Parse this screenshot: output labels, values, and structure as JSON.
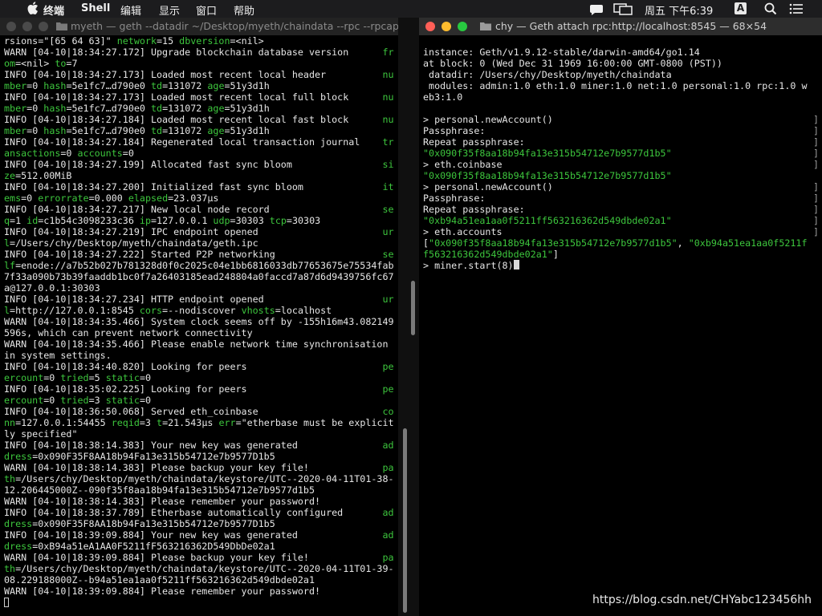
{
  "menubar": {
    "app_name": "终端",
    "menus": [
      "Shell",
      "编辑",
      "显示",
      "窗口",
      "帮助"
    ],
    "clock": "周五 下午6:39",
    "input_method": "A"
  },
  "left_window": {
    "title": "myeth — geth --datadir ~/Desktop/myeth/chaindata --rpc --rpcapi e..."
  },
  "right_window": {
    "title": "chy — Geth attach rpc:http://localhost:8545 — 68×54"
  },
  "left_lines": [
    [
      [
        "rsions=\"[65 64 63]\" ",
        ""
      ],
      [
        "network",
        "g"
      ],
      [
        "=15 ",
        ""
      ],
      [
        "dbversion",
        "g"
      ],
      [
        "=<nil>",
        ""
      ]
    ],
    [
      [
        "WARN [04-10|18:34:27.172] Upgrade blockchain database version      ",
        ""
      ],
      [
        "fr",
        "g"
      ]
    ],
    [
      [
        "om",
        "g"
      ],
      [
        "=<nil> ",
        ""
      ],
      [
        "to",
        "g"
      ],
      [
        "=7",
        ""
      ]
    ],
    [
      [
        "INFO [04-10|18:34:27.173] Loaded most recent local header          ",
        ""
      ],
      [
        "nu",
        "g"
      ]
    ],
    [
      [
        "mber",
        "g"
      ],
      [
        "=0 ",
        ""
      ],
      [
        "hash",
        "g"
      ],
      [
        "=5e1fc7…d790e0 ",
        ""
      ],
      [
        "td",
        "g"
      ],
      [
        "=131072 ",
        ""
      ],
      [
        "age",
        "g"
      ],
      [
        "=51y3d1h",
        ""
      ]
    ],
    [
      [
        "INFO [04-10|18:34:27.173] Loaded most recent local full block      ",
        ""
      ],
      [
        "nu",
        "g"
      ]
    ],
    [
      [
        "mber",
        "g"
      ],
      [
        "=0 ",
        ""
      ],
      [
        "hash",
        "g"
      ],
      [
        "=5e1fc7…d790e0 ",
        ""
      ],
      [
        "td",
        "g"
      ],
      [
        "=131072 ",
        ""
      ],
      [
        "age",
        "g"
      ],
      [
        "=51y3d1h",
        ""
      ]
    ],
    [
      [
        "INFO [04-10|18:34:27.184] Loaded most recent local fast block      ",
        ""
      ],
      [
        "nu",
        "g"
      ]
    ],
    [
      [
        "mber",
        "g"
      ],
      [
        "=0 ",
        ""
      ],
      [
        "hash",
        "g"
      ],
      [
        "=5e1fc7…d790e0 ",
        ""
      ],
      [
        "td",
        "g"
      ],
      [
        "=131072 ",
        ""
      ],
      [
        "age",
        "g"
      ],
      [
        "=51y3d1h",
        ""
      ]
    ],
    [
      [
        "INFO [04-10|18:34:27.184] Regenerated local transaction journal    ",
        ""
      ],
      [
        "tr",
        "g"
      ]
    ],
    [
      [
        "ansactions",
        "g"
      ],
      [
        "=0 ",
        ""
      ],
      [
        "accounts",
        "g"
      ],
      [
        "=0",
        ""
      ]
    ],
    [
      [
        "INFO [04-10|18:34:27.199] Allocated fast sync bloom                ",
        ""
      ],
      [
        "si",
        "g"
      ]
    ],
    [
      [
        "ze",
        "g"
      ],
      [
        "=512.00MiB",
        ""
      ]
    ],
    [
      [
        "INFO [04-10|18:34:27.200] Initialized fast sync bloom              ",
        ""
      ],
      [
        "it",
        "g"
      ]
    ],
    [
      [
        "ems",
        "g"
      ],
      [
        "=0 ",
        ""
      ],
      [
        "errorrate",
        "g"
      ],
      [
        "=0.000 ",
        ""
      ],
      [
        "elapsed",
        "g"
      ],
      [
        "=23.037µs",
        ""
      ]
    ],
    [
      [
        "INFO [04-10|18:34:27.217] New local node record                    ",
        ""
      ],
      [
        "se",
        "g"
      ]
    ],
    [
      [
        "q",
        "g"
      ],
      [
        "=1 ",
        ""
      ],
      [
        "id",
        "g"
      ],
      [
        "=c1b54c3098233c36 ",
        ""
      ],
      [
        "ip",
        "g"
      ],
      [
        "=127.0.0.1 ",
        ""
      ],
      [
        "udp",
        "g"
      ],
      [
        "=30303 ",
        ""
      ],
      [
        "tcp",
        "g"
      ],
      [
        "=30303",
        ""
      ]
    ],
    [
      [
        "INFO [04-10|18:34:27.219] IPC endpoint opened                      ",
        ""
      ],
      [
        "ur",
        "g"
      ]
    ],
    [
      [
        "l",
        "g"
      ],
      [
        "=/Users/chy/Desktop/myeth/chaindata/geth.ipc",
        ""
      ]
    ],
    [
      [
        "INFO [04-10|18:34:27.222] Started P2P networking                   ",
        ""
      ],
      [
        "se",
        "g"
      ]
    ],
    [
      [
        "lf",
        "g"
      ],
      [
        "=enode://a7b52b027b781328d0f0c2025c04e1bb6816033db77653675e75534fab",
        ""
      ]
    ],
    [
      [
        "7f33a090b73b39faaddb1bc0f7a26403185ead248804a0faccd7a87d6d9439756fc67",
        ""
      ]
    ],
    [
      [
        "a@127.0.0.1:30303",
        ""
      ]
    ],
    [
      [
        "INFO [04-10|18:34:27.234] HTTP endpoint opened                     ",
        ""
      ],
      [
        "ur",
        "g"
      ]
    ],
    [
      [
        "l",
        "g"
      ],
      [
        "=http://127.0.0.1:8545 ",
        ""
      ],
      [
        "cors",
        "g"
      ],
      [
        "=--nodiscover ",
        ""
      ],
      [
        "vhosts",
        "g"
      ],
      [
        "=localhost",
        ""
      ]
    ],
    [
      [
        "WARN [04-10|18:34:35.466] System clock seems off by -155h16m43.082149",
        ""
      ]
    ],
    [
      [
        "596s, which can prevent network connectivity",
        ""
      ]
    ],
    [
      [
        "WARN [04-10|18:34:35.466] Please enable network time synchronisation",
        ""
      ]
    ],
    [
      [
        "in system settings.",
        ""
      ]
    ],
    [
      [
        "INFO [04-10|18:34:40.820] Looking for peers                        ",
        ""
      ],
      [
        "pe",
        "g"
      ]
    ],
    [
      [
        "ercount",
        "g"
      ],
      [
        "=0 ",
        ""
      ],
      [
        "tried",
        "g"
      ],
      [
        "=5 ",
        ""
      ],
      [
        "static",
        "g"
      ],
      [
        "=0",
        ""
      ]
    ],
    [
      [
        "INFO [04-10|18:35:02.225] Looking for peers                        ",
        ""
      ],
      [
        "pe",
        "g"
      ]
    ],
    [
      [
        "ercount",
        "g"
      ],
      [
        "=0 ",
        ""
      ],
      [
        "tried",
        "g"
      ],
      [
        "=3 ",
        ""
      ],
      [
        "static",
        "g"
      ],
      [
        "=0",
        ""
      ]
    ],
    [
      [
        "INFO [04-10|18:36:50.068] Served eth_coinbase                      ",
        ""
      ],
      [
        "co",
        "g"
      ]
    ],
    [
      [
        "nn",
        "g"
      ],
      [
        "=127.0.0.1:54455 ",
        ""
      ],
      [
        "reqid",
        "g"
      ],
      [
        "=3 ",
        ""
      ],
      [
        "t",
        "g"
      ],
      [
        "=21.543µs ",
        ""
      ],
      [
        "err",
        "g"
      ],
      [
        "=\"etherbase must be explicit",
        ""
      ]
    ],
    [
      [
        "ly specified\"",
        ""
      ]
    ],
    [
      [
        "INFO [04-10|18:38:14.383] Your new key was generated               ",
        ""
      ],
      [
        "ad",
        "g"
      ]
    ],
    [
      [
        "dress",
        "g"
      ],
      [
        "=0x090F35F8AA18b94Fa13e315b54712e7b9577D1b5",
        ""
      ]
    ],
    [
      [
        "WARN [04-10|18:38:14.383] Please backup your key file!             ",
        ""
      ],
      [
        "pa",
        "g"
      ]
    ],
    [
      [
        "th",
        "g"
      ],
      [
        "=/Users/chy/Desktop/myeth/chaindata/keystore/UTC--2020-04-11T01-38-",
        ""
      ]
    ],
    [
      [
        "12.206445000Z--090f35f8aa18b94fa13e315b54712e7b9577d1b5",
        ""
      ]
    ],
    [
      [
        "WARN [04-10|18:38:14.383] Please remember your password!",
        ""
      ]
    ],
    [
      [
        "INFO [04-10|18:38:37.789] Etherbase automatically configured       ",
        ""
      ],
      [
        "ad",
        "g"
      ]
    ],
    [
      [
        "dress",
        "g"
      ],
      [
        "=0x090F35F8AA18b94Fa13e315b54712e7b9577D1b5",
        ""
      ]
    ],
    [
      [
        "INFO [04-10|18:39:09.884] Your new key was generated               ",
        ""
      ],
      [
        "ad",
        "g"
      ]
    ],
    [
      [
        "dress",
        "g"
      ],
      [
        "=0xB94a51eA1AA0F5211fF563216362D549DbDe02a1",
        ""
      ]
    ],
    [
      [
        "WARN [04-10|18:39:09.884] Please backup your key file!             ",
        ""
      ],
      [
        "pa",
        "g"
      ]
    ],
    [
      [
        "th",
        "g"
      ],
      [
        "=/Users/chy/Desktop/myeth/chaindata/keystore/UTC--2020-04-11T01-39-",
        ""
      ]
    ],
    [
      [
        "08.229188000Z--b94a51ea1aa0f5211ff563216362d549dbde02a1",
        ""
      ]
    ],
    [
      [
        "WARN [04-10|18:39:09.884] Please remember your password!",
        ""
      ]
    ]
  ],
  "right_lines": [
    [
      [
        "",
        ""
      ]
    ],
    [
      [
        "instance: Geth/v1.9.12-stable/darwin-amd64/go1.14",
        ""
      ]
    ],
    [
      [
        "at block: 0 (Wed Dec 31 1969 16:00:00 GMT-0800 (PST))",
        ""
      ]
    ],
    [
      [
        " datadir: /Users/chy/Desktop/myeth/chaindata",
        ""
      ]
    ],
    [
      [
        " modules: admin:1.0 eth:1.0 miner:1.0 net:1.0 personal:1.0 rpc:1.0 w",
        ""
      ]
    ],
    [
      [
        "eb3:1.0",
        ""
      ]
    ],
    [
      [
        "",
        ""
      ]
    ],
    [
      [
        "> personal.newAccount()",
        ""
      ]
    ],
    [
      [
        "Passphrase:",
        ""
      ]
    ],
    [
      [
        "Repeat passphrase:",
        ""
      ]
    ],
    [
      [
        "\"0x090f35f8aa18b94fa13e315b54712e7b9577d1b5\"",
        "g"
      ]
    ],
    [
      [
        "> eth.coinbase",
        ""
      ]
    ],
    [
      [
        "\"0x090f35f8aa18b94fa13e315b54712e7b9577d1b5\"",
        "g"
      ]
    ],
    [
      [
        "> personal.newAccount()",
        ""
      ]
    ],
    [
      [
        "Passphrase:",
        ""
      ]
    ],
    [
      [
        "Repeat passphrase:",
        ""
      ]
    ],
    [
      [
        "\"0xb94a51ea1aa0f5211ff563216362d549dbde02a1\"",
        "g"
      ]
    ],
    [
      [
        "> eth.accounts",
        ""
      ]
    ],
    [
      [
        "[",
        ""
      ],
      [
        "\"0x090f35f8aa18b94fa13e315b54712e7b9577d1b5\"",
        "g"
      ],
      [
        ", ",
        ""
      ],
      [
        "\"0xb94a51ea1aa0f5211f",
        "g"
      ]
    ],
    [
      [
        "f563216362d549dbde02a1\"",
        "g"
      ],
      [
        "]",
        ""
      ]
    ],
    [
      [
        "> miner.start(8)",
        ""
      ]
    ]
  ],
  "watermark": "https://blog.csdn.net/CHYabc123456hh",
  "colors": {
    "green": "#3dc63d",
    "text": "#e6e6e6",
    "red": "#ff5f57",
    "yellow": "#febc2e",
    "lime": "#28c840"
  }
}
